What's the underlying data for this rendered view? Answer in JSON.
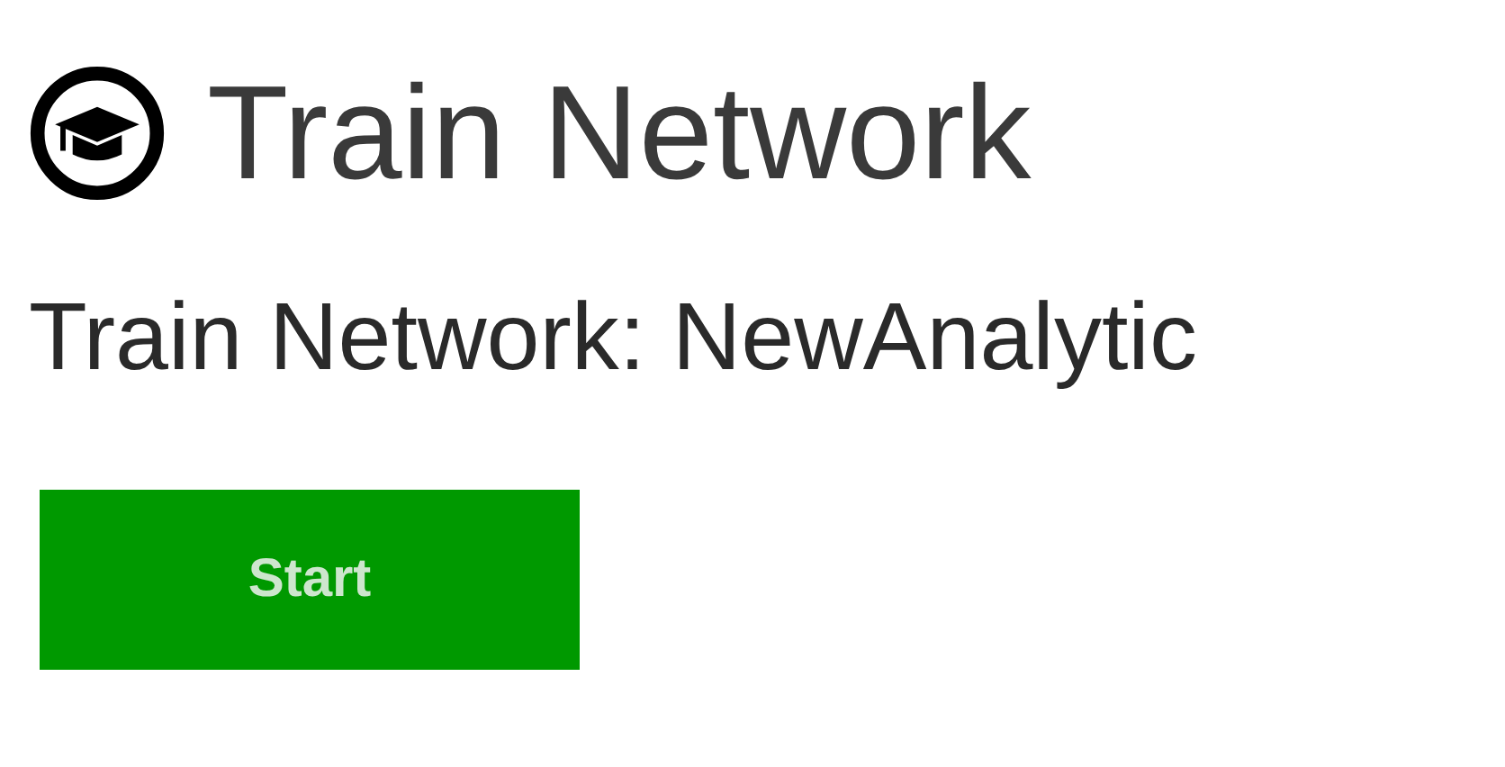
{
  "page": {
    "title": "Train Network"
  },
  "subtitle": "Train Network: NewAnalytic",
  "buttons": [
    {
      "label": "Start",
      "kind": "primary"
    }
  ]
}
